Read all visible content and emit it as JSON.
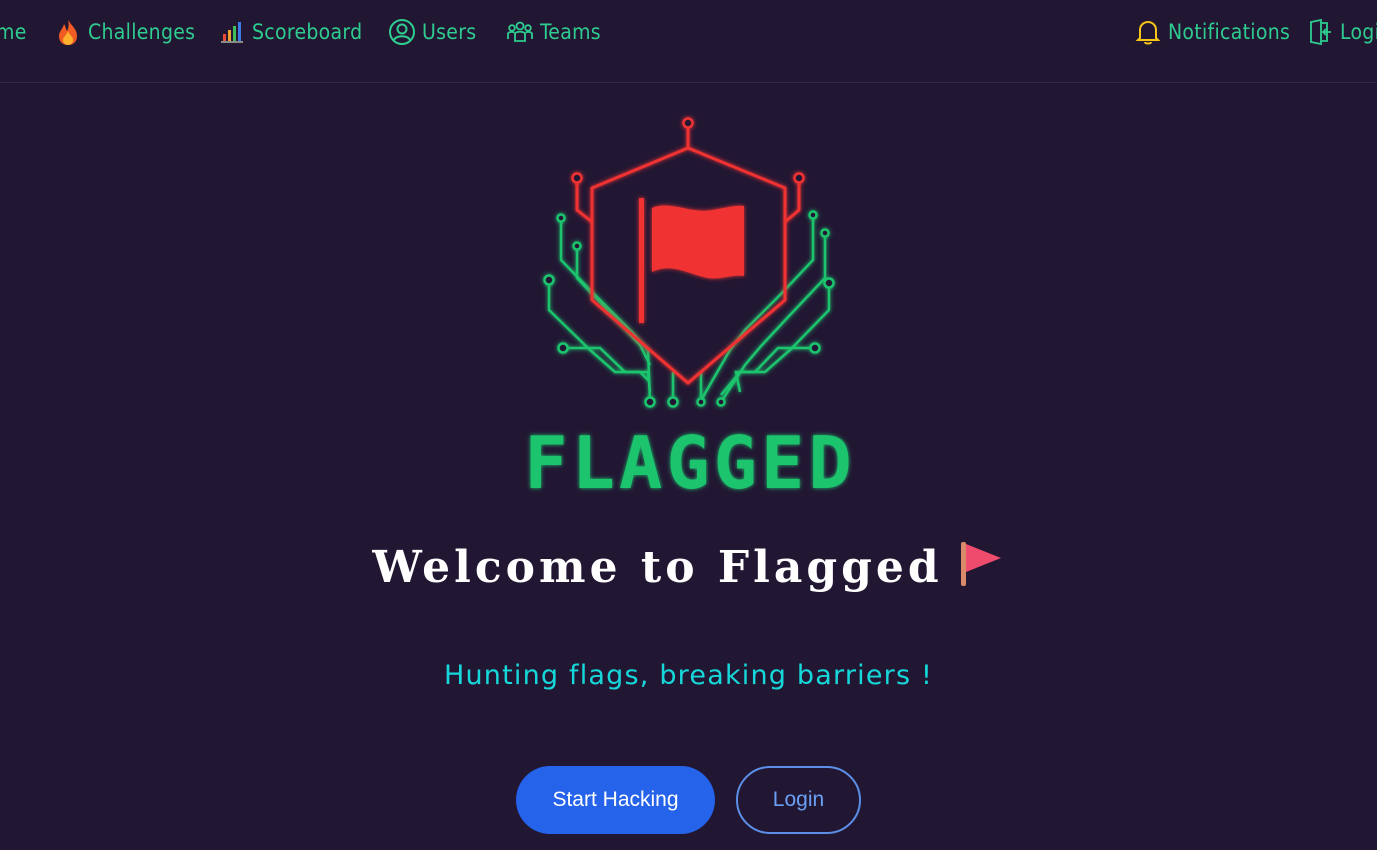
{
  "colors": {
    "background": "#221733",
    "nav_text": "#2ecc8f",
    "accent_red": "#f03232",
    "accent_green": "#1fc46e",
    "tagline": "#16d8da",
    "primary_button": "#2563eb"
  },
  "nav": {
    "items": [
      {
        "label": "me",
        "icon": "home-icon"
      },
      {
        "label": "Challenges",
        "icon": "fire-icon"
      },
      {
        "label": "Scoreboard",
        "icon": "bar-chart-icon"
      },
      {
        "label": "Users",
        "icon": "user-circle-icon"
      },
      {
        "label": "Teams",
        "icon": "team-icon"
      }
    ],
    "right": [
      {
        "label": "Notifications",
        "icon": "bell-icon"
      },
      {
        "label": "Logi",
        "icon": "login-icon"
      }
    ]
  },
  "hero": {
    "logo_text": "FLAGGED",
    "logo_icon": "shield-flag-logo",
    "welcome": "Welcome to Flagged",
    "welcome_emoji": "triangular-flag-emoji",
    "tagline": "Hunting flags, breaking barriers !"
  },
  "actions": {
    "start_hacking": "Start Hacking",
    "login": "Login"
  }
}
